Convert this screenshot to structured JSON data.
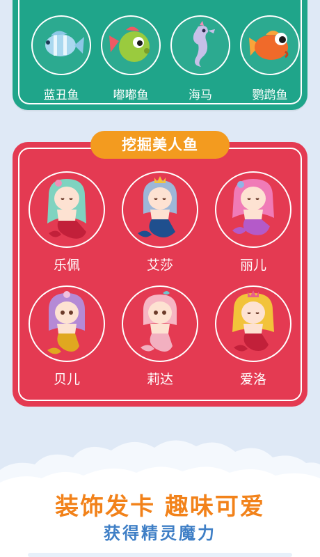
{
  "fish_section": {
    "items": [
      {
        "name": "蓝丑鱼",
        "icon": "clownfish-blue-icon",
        "color": "#9ed1ec"
      },
      {
        "name": "嘟嘟鱼",
        "icon": "puffer-fish-green-icon",
        "color": "#9acb3e"
      },
      {
        "name": "海马",
        "icon": "seahorse-icon",
        "color": "#c7c0e8"
      },
      {
        "name": "鹦鹉鱼",
        "icon": "parrot-fish-orange-icon",
        "color": "#f06a2a"
      }
    ]
  },
  "mermaid_section": {
    "title": "挖掘美人鱼",
    "items": [
      {
        "name": "乐佩",
        "icon": "mermaid-green-hair-icon",
        "hair": "#7fd3c0",
        "tail": "#c2203a"
      },
      {
        "name": "艾莎",
        "icon": "mermaid-blue-hair-icon",
        "hair": "#9db7d8",
        "tail": "#1f4f8e"
      },
      {
        "name": "丽儿",
        "icon": "mermaid-pink-hair-icon",
        "hair": "#f07bb7",
        "tail": "#b45ac9"
      },
      {
        "name": "贝儿",
        "icon": "mermaid-purple-hair-icon",
        "hair": "#b58ad6",
        "tail": "#e0a820"
      },
      {
        "name": "莉达",
        "icon": "mermaid-peach-hair-icon",
        "hair": "#f6b6c4",
        "tail": "#f2b0c0"
      },
      {
        "name": "爱洛",
        "icon": "mermaid-blonde-hair-icon",
        "hair": "#f2c33a",
        "tail": "#c2203a"
      }
    ]
  },
  "slogan": {
    "line1": "装饰发卡  趣味可爱",
    "line2": "获得精灵魔力"
  },
  "colors": {
    "teal": "#1fa58a",
    "red": "#e43a52",
    "banner": "#f39b1f",
    "slogan_orange": "#f2821a",
    "slogan_blue": "#3f7fc6"
  }
}
